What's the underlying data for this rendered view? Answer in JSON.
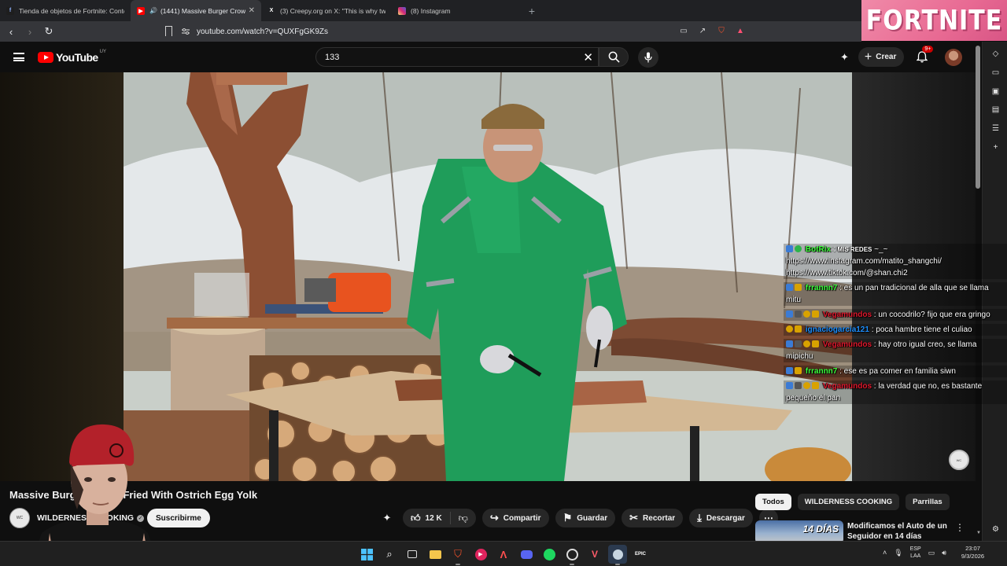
{
  "browser": {
    "tabs": [
      {
        "title": "Tienda de objetos de Fortnite: Conte",
        "favicon": "fortnite-icon",
        "color": "#7a5cff",
        "active": false
      },
      {
        "title": "(1441) Massive Burger Crown",
        "favicon": "youtube-icon",
        "color": "#ff0000",
        "active": true
      },
      {
        "title": "(3) Creepy.org on X: \"This is why two",
        "favicon": "x-icon",
        "color": "#000000",
        "active": false
      },
      {
        "title": "(8) Instagram",
        "favicon": "instagram-icon",
        "color": "#d62976",
        "active": false
      }
    ],
    "url": "youtube.com/watch?v=QUXFgGK9Zs"
  },
  "overlay": {
    "fortnite_logo": "FORTNITE"
  },
  "youtube": {
    "logo_text": "YouTube",
    "region": "UY",
    "search_query": "133",
    "create_label": "Crear",
    "notifications_badge": "9+"
  },
  "chat": [
    {
      "name": "BotRix",
      "name_color": "#3cff3c",
      "text_prefix": " : ",
      "smallcaps": "MIS REDES",
      "text": " ~_~ https://www.instagram.com/matito_shangchi/ https://www.tiktok.com/@shan.chi2"
    },
    {
      "name": "frrannn7",
      "name_color": "#3cff3c",
      "text": " : es un pan tradicional de alla que se llama mitu"
    },
    {
      "name": "Vegamundos",
      "name_color": "#e0182d",
      "text": " : un cocodrilo? fijo que era gringo"
    },
    {
      "name": "ignaciogarcia121",
      "name_color": "#1e90ff",
      "text": " : poca hambre tiene el culiao"
    },
    {
      "name": "Vegamundos",
      "name_color": "#e0182d",
      "text": " : hay otro igual creo, se llama mipichu"
    },
    {
      "name": "frrannn7",
      "name_color": "#3cff3c",
      "text": " : ese es pa comer en familia siwn"
    },
    {
      "name": "Vegamundos",
      "name_color": "#e0182d",
      "text": " : la verdad que no, es bastante pequeño el pan"
    }
  ],
  "video": {
    "title": "Massive Burger Crown Fried With Ostrich Egg Yolk",
    "channel": "WILDERNESS COOKING",
    "subscribe_label": "Suscribirme",
    "likes": "12 K",
    "share_label": "Compartir",
    "save_label": "Guardar",
    "clip_label": "Recortar",
    "download_label": "Descargar"
  },
  "sidebar": {
    "chips": [
      "Todos",
      "WILDERNESS COOKING",
      "Parrillas"
    ],
    "recommendation": {
      "title": "Modificamos el Auto de un Seguidor en 14 días",
      "thumb_text": "14 DÍAS"
    }
  },
  "taskbar": {
    "lang_top": "ESP",
    "lang_bottom": "LAA",
    "time": "23:07",
    "date": "9/3/2026"
  }
}
